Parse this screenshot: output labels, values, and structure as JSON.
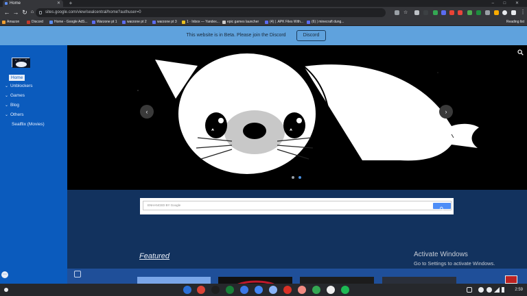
{
  "browser": {
    "tab_title": "Home",
    "new_tab": "+",
    "window_controls": "– □ ✕",
    "url": "sites.google.com/view/sealcentral/home?authuser=0",
    "bookmarks": [
      {
        "label": "Amazon",
        "color": "#f0a030"
      },
      {
        "label": "Discord",
        "color": "#c0392b"
      },
      {
        "label": "Home - Google AdS...",
        "color": "#5b8def"
      },
      {
        "label": "Warzone pt 1",
        "color": "#5b6cf0"
      },
      {
        "label": "warzone pt 2",
        "color": "#5b6cf0"
      },
      {
        "label": "warzone pt 3",
        "color": "#5b6cf0"
      },
      {
        "label": "1 · Inbox — Yandex...",
        "color": "#e8c020"
      },
      {
        "label": "epic games launcher",
        "color": "#cccccc"
      },
      {
        "label": "(4) | .APK Files With...",
        "color": "#5b6cf0"
      },
      {
        "label": "(6) | minecraft dung...",
        "color": "#5b6cf0"
      }
    ],
    "reading_list": "Reading list"
  },
  "banner": {
    "text": "This website is in Beta. Please join the Discord",
    "button": "Discord"
  },
  "sidebar": {
    "items": [
      {
        "label": "Home"
      },
      {
        "label": "Unblockers",
        "chevron": "⌄"
      },
      {
        "label": "Games",
        "chevron": "⌄"
      },
      {
        "label": "Blog",
        "chevron": "⌄"
      },
      {
        "label": "Others",
        "chevron": "⌄"
      },
      {
        "label": "Sealflix (Movies)"
      }
    ]
  },
  "carousel": {
    "prev": "‹",
    "next": "›",
    "slides": 2,
    "active_slide": 2
  },
  "search": {
    "placeholder": "ENHANCED BY Google"
  },
  "featured": "Featured",
  "activate": {
    "title": "Activate Windows",
    "subtitle": "Go to Settings to activate Windows."
  },
  "shelf": {
    "time": "2:59",
    "apps": [
      "#2a6fd6",
      "#db4437",
      "#1e1e1e",
      "#188038",
      "#3b78e7",
      "#4285f4",
      "#8ab4f8",
      "#d93025",
      "#f28b82",
      "#34a853",
      "#eeeeee",
      "#1db954"
    ]
  },
  "colors": {
    "banner": "#5fa2dd",
    "sidebar": "#0b5bbd",
    "page": "#12325e"
  }
}
